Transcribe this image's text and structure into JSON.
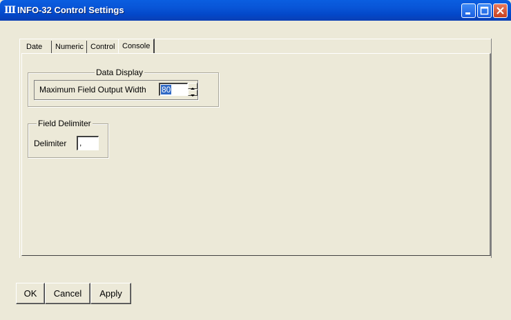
{
  "window": {
    "title": "INFO-32 Control Settings",
    "icon": "app-icon"
  },
  "tabs": [
    {
      "label": "Date",
      "active": false
    },
    {
      "label": "Numeric",
      "active": false
    },
    {
      "label": "Control",
      "active": false
    },
    {
      "label": "Console",
      "active": true
    }
  ],
  "data_display": {
    "group_title": "Data Display",
    "max_width_label": "Maximum Field Output Width",
    "max_width_value": "80"
  },
  "field_delimiter": {
    "group_title": "Field Delimiter",
    "delimiter_label": "Delimiter",
    "delimiter_value": ","
  },
  "buttons": {
    "ok": "OK",
    "cancel": "Cancel",
    "apply": "Apply"
  },
  "colors": {
    "titlebar": "#0854d6",
    "dialog_bg": "#ece9d8",
    "selection": "#316ac5"
  }
}
